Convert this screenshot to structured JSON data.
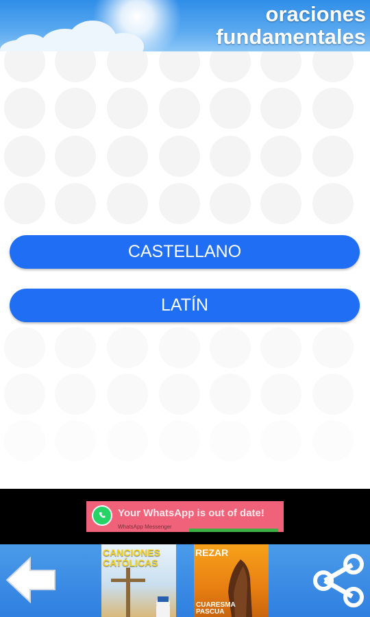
{
  "header": {
    "title_line1": "oraciones",
    "title_line2": "fundamentales"
  },
  "languages": [
    {
      "label": "CASTELLANO"
    },
    {
      "label": "LATÍN"
    }
  ],
  "ad": {
    "text": "Your WhatsApp is out of date!",
    "subtext": "WhatsApp Messenger",
    "icon": "whatsapp-icon",
    "color": "#f0627a"
  },
  "bottom_bar": {
    "back_icon": "arrow-left-icon",
    "share_icon": "share-icon",
    "apps": [
      {
        "title_line1": "CANCIONES",
        "title_line2": "CATÓLICAS"
      },
      {
        "title": "REZAR",
        "sub_line1": "CUARESMA",
        "sub_line2": "PASCUA"
      }
    ]
  },
  "colors": {
    "button": "#1f6ef3",
    "header": "#2f8ee8",
    "bottom_bar": "#3a8de6"
  }
}
